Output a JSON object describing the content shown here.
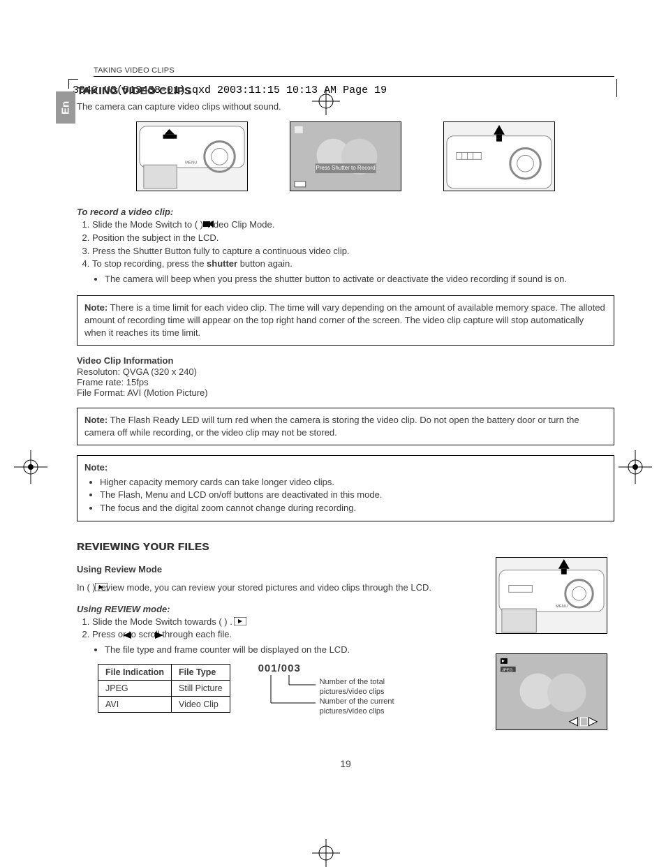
{
  "slug": "3040 UG(513438-01).qxd  2003:11:15  10:13 AM  Page 19",
  "running_head": "TAKING VIDEO CLIPS",
  "lang_tab": "En",
  "section1": {
    "title": "TAKING VIDEO CLIPS",
    "intro": "The camera can capture video clips without sound.",
    "screen_overlay": "Press Shutter to Record",
    "record_head": "To record a video clip:",
    "steps": [
      "Slide the Mode Switch to (      ) Video Clip Mode.",
      "Position the subject in the LCD.",
      "Press the Shutter Button fully to capture a continuous video clip.",
      "To stop recording, press the shutter button again."
    ],
    "shutter_bold": "shutter",
    "step4_pre": "To stop recording, press the ",
    "step4_post": " button again.",
    "sub_bullet": "The camera will beep when you press the shutter button to activate or deactivate the video recording if sound is on.",
    "note1_label": "Note:",
    "note1_body": " There is a time limit for each video clip.  The time will vary depending on the amount of available memory space. The alloted amount of recording time will appear on the top right hand corner of the screen.  The video clip capture will stop automatically when it reaches its time limit.",
    "vci_head": "Video Clip Information",
    "vci_lines": [
      "Resoluton:  QVGA (320 x 240)",
      "Frame rate:  15fps",
      "File Format: AVI (Motion Picture)"
    ],
    "note2_label": "Note:",
    "note2_body": "  The Flash Ready LED will turn red when the camera is storing the video clip.  Do not open the battery door or turn the camera off while recording, or the video clip may not be stored.",
    "note3_label": "Note:",
    "note3_items": [
      "Higher capacity memory cards can take longer video clips.",
      "The Flash, Menu and LCD on/off buttons are deactivated in this mode.",
      "The focus and the digital zoom cannot change during recording."
    ]
  },
  "section2": {
    "title": "REVIEWING YOUR FILES",
    "sub_head": "Using Review Mode",
    "intro_pre": "In (       ) review mode, you can review your stored pictures and video clips through the LCD.",
    "use_head": "Using REVIEW mode:",
    "step1": "Slide the Mode Switch towards (        ) .",
    "step2": "Press        or        to scroll through each file.",
    "sub_bullet": "The file type and frame counter will be displayed on the LCD.",
    "table": {
      "h1": "File Indication",
      "h2": "File Type",
      "r1c1": "JPEG",
      "r1c2": "Still Picture",
      "r2c1": "AVI",
      "r2c2": "Video Clip"
    },
    "counter": "001/003",
    "caption_total": "Number of the total pictures/video clips",
    "caption_current": "Number of the current pictures/video clips"
  },
  "page_number": "19"
}
